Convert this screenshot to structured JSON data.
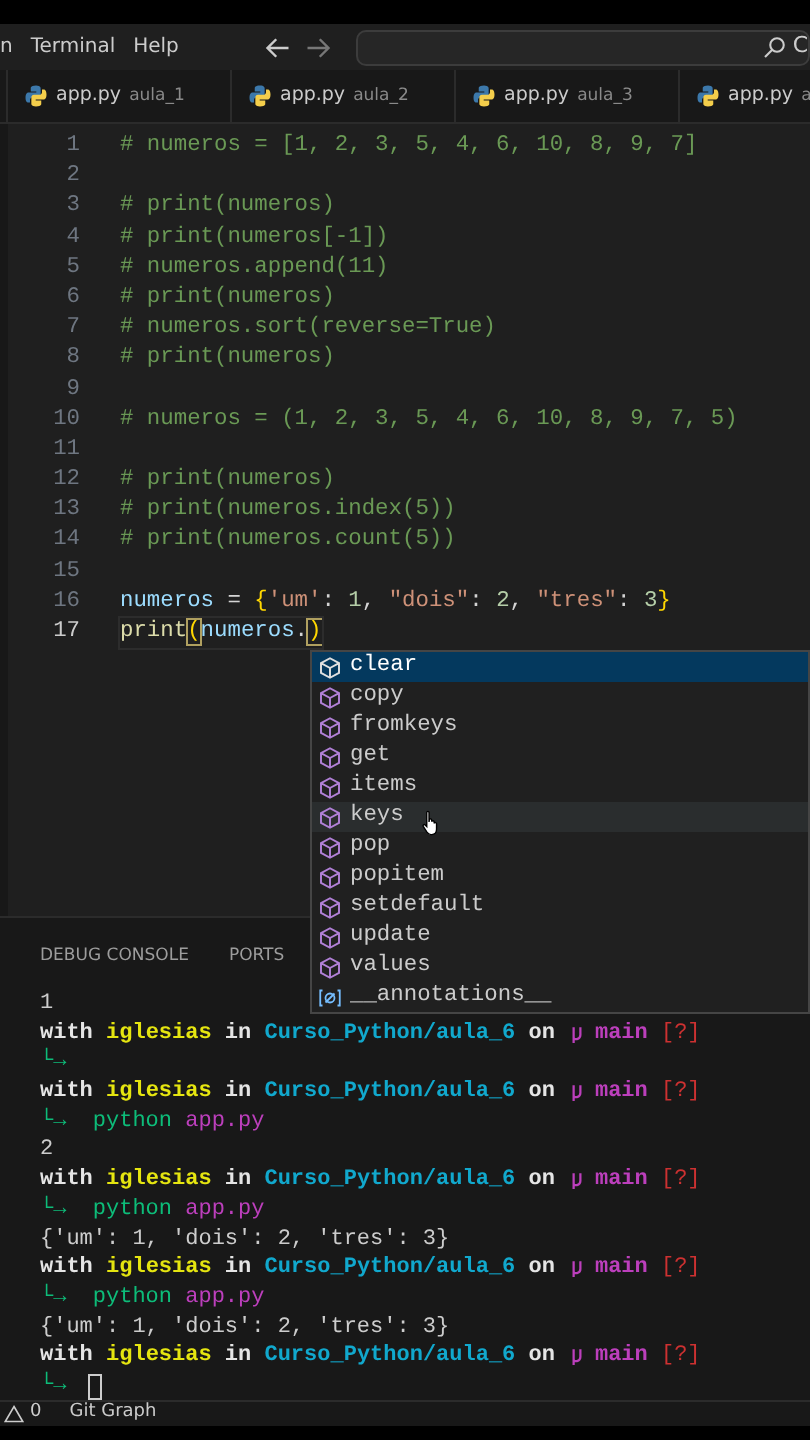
{
  "menu": [
    "n",
    "Terminal",
    "Help"
  ],
  "search": {
    "text": "C"
  },
  "tabs": [
    {
      "file": "app.py",
      "folder": "aula_1"
    },
    {
      "file": "app.py",
      "folder": "aula_2"
    },
    {
      "file": "app.py",
      "folder": "aula_3"
    },
    {
      "file": "app.py",
      "folder": "a"
    }
  ],
  "code": [
    {
      "n": "1",
      "current": false,
      "tokens": [
        {
          "kind": "comment",
          "t": "# numeros = [1, 2, 3, 5, 4, 6, 10, 8, 9, 7]"
        }
      ]
    },
    {
      "n": "2",
      "current": false
    },
    {
      "n": "3",
      "current": false,
      "tokens": [
        {
          "kind": "comment",
          "t": "# print(numeros)"
        }
      ]
    },
    {
      "n": "4",
      "current": false,
      "tokens": [
        {
          "kind": "comment",
          "t": "# print(numeros[-1])"
        }
      ]
    },
    {
      "n": "5",
      "current": false,
      "tokens": [
        {
          "kind": "comment",
          "t": "# numeros.append(11)"
        }
      ]
    },
    {
      "n": "6",
      "current": false,
      "tokens": [
        {
          "kind": "comment",
          "t": "# print(numeros)"
        }
      ]
    },
    {
      "n": "7",
      "current": false,
      "tokens": [
        {
          "kind": "comment",
          "t": "# numeros.sort(reverse=True)"
        }
      ]
    },
    {
      "n": "8",
      "current": false,
      "tokens": [
        {
          "kind": "comment",
          "t": "# print(numeros)"
        }
      ]
    },
    {
      "n": "9",
      "current": false
    },
    {
      "n": "10",
      "current": false,
      "tokens": [
        {
          "kind": "comment",
          "t": "# numeros = (1, 2, 3, 5, 4, 6, 10, 8, 9, 7, 5)"
        }
      ]
    },
    {
      "n": "11",
      "current": false
    },
    {
      "n": "12",
      "current": false,
      "tokens": [
        {
          "kind": "comment",
          "t": "# print(numeros)"
        }
      ]
    },
    {
      "n": "13",
      "current": false,
      "tokens": [
        {
          "kind": "comment",
          "t": "# print(numeros.index(5))"
        }
      ]
    },
    {
      "n": "14",
      "current": false,
      "tokens": [
        {
          "kind": "comment",
          "t": "# print(numeros.count(5))"
        }
      ]
    },
    {
      "n": "15",
      "current": false
    },
    {
      "n": "16",
      "current": false,
      "tokens": [
        {
          "kind": "var",
          "t": "numeros"
        },
        {
          "kind": "op",
          "t": " = "
        },
        {
          "kind": "brace",
          "t": "{"
        },
        {
          "kind": "str",
          "t": "'um'"
        },
        {
          "kind": "op",
          "t": ": "
        },
        {
          "kind": "num",
          "t": "1"
        },
        {
          "kind": "op",
          "t": ", "
        },
        {
          "kind": "str",
          "t": "\"dois\""
        },
        {
          "kind": "op",
          "t": ": "
        },
        {
          "kind": "num",
          "t": "2"
        },
        {
          "kind": "op",
          "t": ", "
        },
        {
          "kind": "str",
          "t": "\"tres\""
        },
        {
          "kind": "op",
          "t": ": "
        },
        {
          "kind": "num",
          "t": "3"
        },
        {
          "kind": "brace",
          "t": "}"
        }
      ]
    },
    {
      "n": "17",
      "current": true,
      "tokens": [
        {
          "kind": "func",
          "t": "print"
        },
        {
          "kind": "match",
          "t": "("
        },
        {
          "kind": "var",
          "t": "numeros"
        },
        {
          "kind": "op",
          "t": "."
        },
        {
          "kind": "match",
          "t": ")"
        }
      ]
    }
  ],
  "suggestions": [
    {
      "label": "clear",
      "kind": "method",
      "selected": true,
      "hovered": false
    },
    {
      "label": "copy",
      "kind": "method",
      "selected": false,
      "hovered": false
    },
    {
      "label": "fromkeys",
      "kind": "method",
      "selected": false,
      "hovered": false
    },
    {
      "label": "get",
      "kind": "method",
      "selected": false,
      "hovered": false
    },
    {
      "label": "items",
      "kind": "method",
      "selected": false,
      "hovered": false
    },
    {
      "label": "keys",
      "kind": "method",
      "selected": false,
      "hovered": true
    },
    {
      "label": "pop",
      "kind": "method",
      "selected": false,
      "hovered": false
    },
    {
      "label": "popitem",
      "kind": "method",
      "selected": false,
      "hovered": false
    },
    {
      "label": "setdefault",
      "kind": "method",
      "selected": false,
      "hovered": false
    },
    {
      "label": "update",
      "kind": "method",
      "selected": false,
      "hovered": false
    },
    {
      "label": "values",
      "kind": "method",
      "selected": false,
      "hovered": false
    },
    {
      "label": "__annotations__",
      "kind": "field",
      "selected": false,
      "hovered": false
    }
  ],
  "panel_tabs": [
    "DEBUG CONSOLE",
    "PORTS"
  ],
  "terminal": [
    {
      "kind": "output",
      "tokens": [
        {
          "kind": "plain",
          "t": "1"
        }
      ]
    },
    {
      "kind": "prompt",
      "left": [
        {
          "kind": "w",
          "t": "with "
        },
        {
          "kind": "user",
          "t": "iglesias"
        },
        {
          "kind": "w",
          "t": " in "
        },
        {
          "kind": "path",
          "t": "Curso_Python/aula_6"
        },
        {
          "kind": "w",
          "t": " on"
        }
      ],
      "right": [
        {
          "kind": "branch",
          "t": "main "
        },
        {
          "kind": "status",
          "t": "[?]"
        }
      ]
    },
    {
      "kind": "output",
      "cursor": false,
      "tokens": [
        {
          "kind": "arrow",
          "t": "└→"
        }
      ]
    },
    {
      "kind": "prompt",
      "left": [
        {
          "kind": "w",
          "t": "with "
        },
        {
          "kind": "user",
          "t": "iglesias"
        },
        {
          "kind": "w",
          "t": " in "
        },
        {
          "kind": "path",
          "t": "Curso_Python/aula_6"
        },
        {
          "kind": "w",
          "t": " on"
        }
      ],
      "right": [
        {
          "kind": "branch",
          "t": "main "
        },
        {
          "kind": "status",
          "t": "[?]"
        }
      ]
    },
    {
      "kind": "output",
      "cursor": false,
      "tokens": [
        {
          "kind": "arrow",
          "t": "└→  "
        },
        {
          "kind": "cmd",
          "t": "python "
        },
        {
          "kind": "arg",
          "t": "app.py"
        }
      ]
    },
    {
      "kind": "output",
      "cursor": false,
      "tokens": [
        {
          "kind": "plain",
          "t": "2"
        }
      ]
    },
    {
      "kind": "prompt",
      "left": [
        {
          "kind": "w",
          "t": "with "
        },
        {
          "kind": "user",
          "t": "iglesias"
        },
        {
          "kind": "w",
          "t": " in "
        },
        {
          "kind": "path",
          "t": "Curso_Python/aula_6"
        },
        {
          "kind": "w",
          "t": " on"
        }
      ],
      "right": [
        {
          "kind": "branch",
          "t": "main "
        },
        {
          "kind": "status",
          "t": "[?]"
        }
      ]
    },
    {
      "kind": "output",
      "cursor": false,
      "tokens": [
        {
          "kind": "arrow",
          "t": "└→  "
        },
        {
          "kind": "cmd",
          "t": "python "
        },
        {
          "kind": "arg",
          "t": "app.py"
        }
      ]
    },
    {
      "kind": "output",
      "cursor": false,
      "tokens": [
        {
          "kind": "plain",
          "t": "{'um': 1, 'dois': 2, 'tres': 3}"
        }
      ]
    },
    {
      "kind": "prompt",
      "left": [
        {
          "kind": "w",
          "t": "with "
        },
        {
          "kind": "user",
          "t": "iglesias"
        },
        {
          "kind": "w",
          "t": " in "
        },
        {
          "kind": "path",
          "t": "Curso_Python/aula_6"
        },
        {
          "kind": "w",
          "t": " on"
        }
      ],
      "right": [
        {
          "kind": "branch",
          "t": "main "
        },
        {
          "kind": "status",
          "t": "[?]"
        }
      ]
    },
    {
      "kind": "output",
      "cursor": false,
      "tokens": [
        {
          "kind": "arrow",
          "t": "└→  "
        },
        {
          "kind": "cmd",
          "t": "python "
        },
        {
          "kind": "arg",
          "t": "app.py"
        }
      ]
    },
    {
      "kind": "output",
      "cursor": false,
      "tokens": [
        {
          "kind": "plain",
          "t": "{'um': 1, 'dois': 2, 'tres': 3}"
        }
      ]
    },
    {
      "kind": "prompt",
      "left": [
        {
          "kind": "w",
          "t": "with "
        },
        {
          "kind": "user",
          "t": "iglesias"
        },
        {
          "kind": "w",
          "t": " in "
        },
        {
          "kind": "path",
          "t": "Curso_Python/aula_6"
        },
        {
          "kind": "w",
          "t": " on"
        }
      ],
      "right": [
        {
          "kind": "branch",
          "t": "main "
        },
        {
          "kind": "status",
          "t": "[?]"
        }
      ]
    },
    {
      "kind": "output",
      "cursor": true,
      "tokens": [
        {
          "kind": "arrow",
          "t": "└→"
        }
      ]
    }
  ],
  "status_bar": {
    "warnings": "0",
    "git": "Git Graph"
  }
}
